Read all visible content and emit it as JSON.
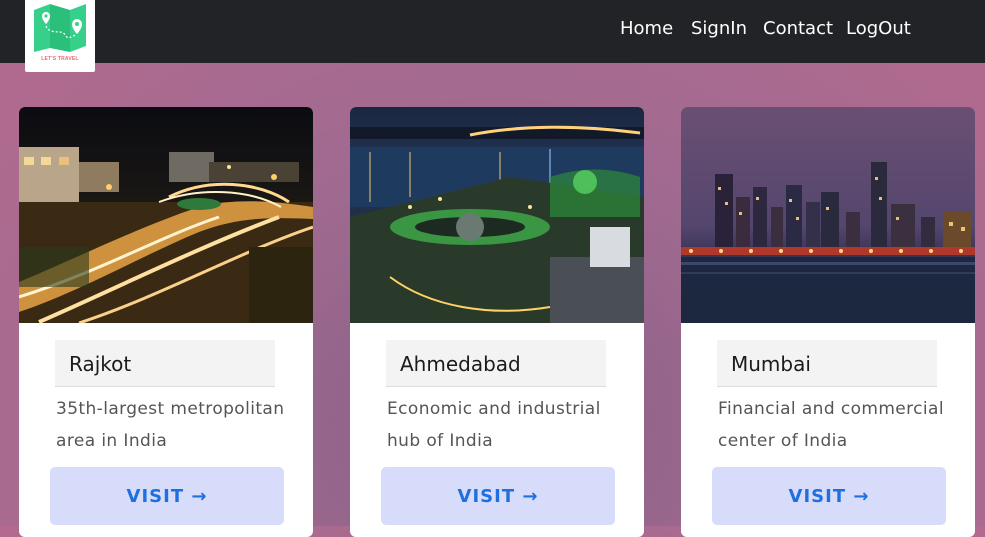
{
  "brand": {
    "logo_text": "LET'S TRAVEL"
  },
  "nav": {
    "home": "Home",
    "signin": "SignIn",
    "contact": "Contact",
    "logout": "LogOut"
  },
  "cards": [
    {
      "title": "Rajkot",
      "description": "35th-largest metropolitan area in India",
      "button": "VISIT →"
    },
    {
      "title": "Ahmedabad",
      "description": "Economic and industrial hub of India",
      "button": "VISIT →"
    },
    {
      "title": "Mumbai",
      "description": "Financial and commercial center of India",
      "button": "VISIT →"
    }
  ],
  "colors": {
    "navbar": "#212327",
    "button_bg": "#d8dcfb",
    "button_text": "#1e6fe0",
    "logo_map": "#36d08a",
    "logo_text": "#e86a7a"
  }
}
